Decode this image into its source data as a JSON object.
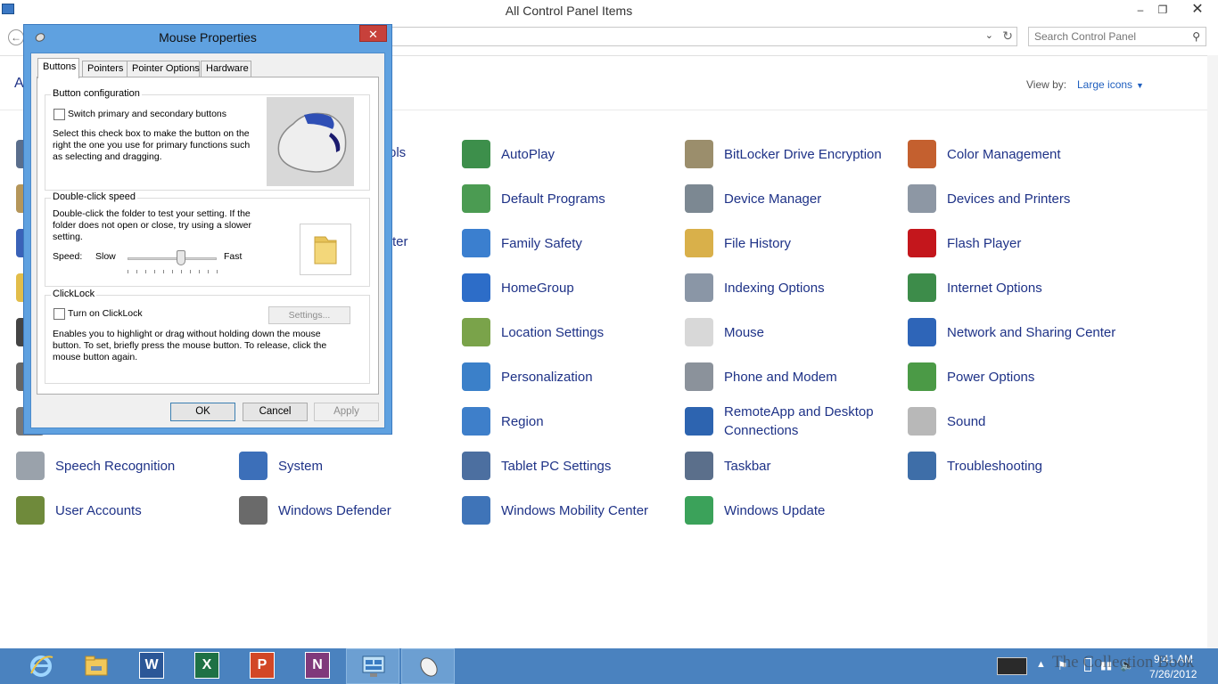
{
  "window": {
    "title": "All Control Panel Items",
    "minimize": "–",
    "restore": "❐",
    "close": "✕"
  },
  "search": {
    "placeholder": "Search Control Panel"
  },
  "header": {
    "adjust_title_partial": "A",
    "view_by_label": "View by:",
    "view_by_value": "Large icons"
  },
  "partial_items": {
    "col2_row1": "ols",
    "col2_row3": "ter"
  },
  "items": [
    {
      "label": "AutoPlay",
      "icon": "autoplay-icon"
    },
    {
      "label": "BitLocker Drive Encryption",
      "icon": "bitlocker-icon"
    },
    {
      "label": "Color Management",
      "icon": "color-management-icon"
    },
    {
      "label": "Default Programs",
      "icon": "default-programs-icon"
    },
    {
      "label": "Device Manager",
      "icon": "device-manager-icon"
    },
    {
      "label": "Devices and Printers",
      "icon": "printer-icon"
    },
    {
      "label": "Family Safety",
      "icon": "family-safety-icon"
    },
    {
      "label": "File History",
      "icon": "file-history-icon"
    },
    {
      "label": "Flash Player",
      "icon": "flash-icon"
    },
    {
      "label": "HomeGroup",
      "icon": "homegroup-icon"
    },
    {
      "label": "Indexing Options",
      "icon": "indexing-icon"
    },
    {
      "label": "Internet Options",
      "icon": "internet-options-icon"
    },
    {
      "label": "Location Settings",
      "icon": "location-icon"
    },
    {
      "label": "Mouse",
      "icon": "mouse-icon"
    },
    {
      "label": "Network and Sharing Center",
      "icon": "network-icon"
    },
    {
      "label": "Personalization",
      "icon": "personalization-icon"
    },
    {
      "label": "Phone and Modem",
      "icon": "phone-icon"
    },
    {
      "label": "Power Options",
      "icon": "power-icon"
    },
    {
      "label": "Region",
      "icon": "region-icon"
    },
    {
      "label": "RemoteApp and Desktop Connections",
      "icon": "remoteapp-icon"
    },
    {
      "label": "Sound",
      "icon": "sound-icon"
    },
    {
      "label": "Speech Recognition",
      "icon": "microphone-icon"
    },
    {
      "label": "System",
      "icon": "system-icon"
    },
    {
      "label": "Tablet PC Settings",
      "icon": "tablet-icon"
    },
    {
      "label": "Taskbar",
      "icon": "taskbar-icon"
    },
    {
      "label": "Troubleshooting",
      "icon": "troubleshooting-icon"
    },
    {
      "label": "User Accounts",
      "icon": "user-accounts-icon"
    },
    {
      "label": "Windows Defender",
      "icon": "defender-icon"
    },
    {
      "label": "Windows Mobility Center",
      "icon": "mobility-icon"
    },
    {
      "label": "Windows Update",
      "icon": "windows-update-icon"
    }
  ],
  "dialog": {
    "title": "Mouse Properties",
    "close": "✕",
    "tabs": [
      "Buttons",
      "Pointers",
      "Pointer Options",
      "Hardware"
    ],
    "button_config": {
      "group": "Button configuration",
      "checkbox": "Switch primary and secondary buttons",
      "description": "Select this check box to make the button on the right the one you use for primary functions such as selecting and dragging."
    },
    "double_click": {
      "group": "Double-click speed",
      "description": "Double-click the folder to test your setting. If the folder does not open or close, try using a slower setting.",
      "speed_label": "Speed:",
      "slow": "Slow",
      "fast": "Fast",
      "speed_value": 0.6
    },
    "clicklock": {
      "group": "ClickLock",
      "checkbox": "Turn on ClickLock",
      "settings_button": "Settings...",
      "description": "Enables you to highlight or drag without holding down the mouse button. To set, briefly press the mouse button. To release, click the mouse button again."
    },
    "ok": "OK",
    "cancel": "Cancel",
    "apply": "Apply"
  },
  "taskbar": {
    "apps": [
      "internet-explorer-icon",
      "file-explorer-icon",
      "word-icon",
      "excel-icon",
      "powerpoint-icon",
      "onenote-icon",
      "control-panel-icon",
      "mouse-icon"
    ],
    "time": "9:41 AM",
    "date": "7/26/2012",
    "watermark": "The Collection Book"
  },
  "colors": {
    "accent_blue": "#1e3287",
    "taskbar": "#4a82bf",
    "dialog_frame": "#5fa1e0",
    "close_red": "#c7413b"
  }
}
